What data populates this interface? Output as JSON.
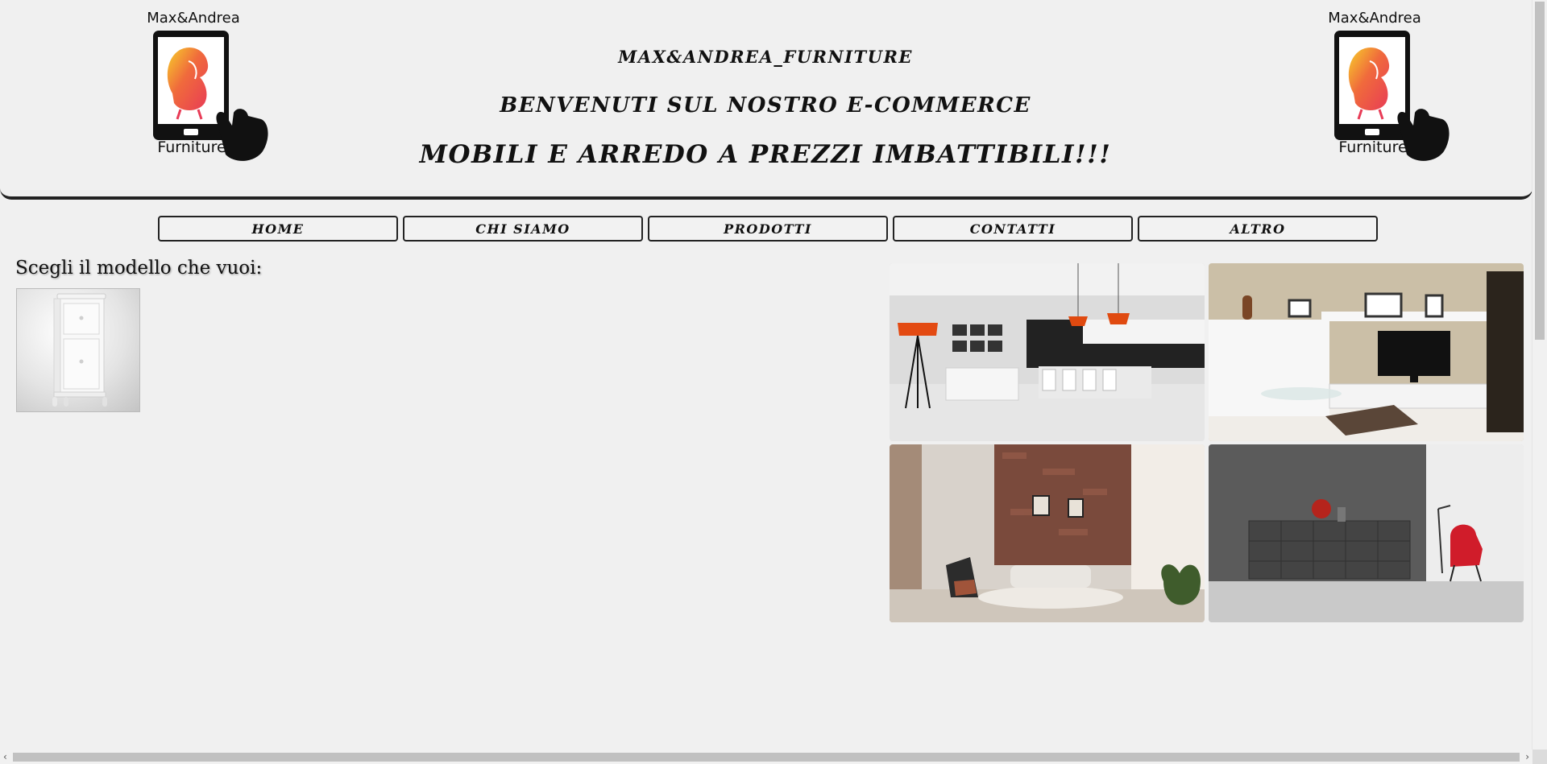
{
  "header": {
    "logo_top_text": "Max&Andrea",
    "logo_bottom_text": "Furniture",
    "title_line1": "MAX&ANDREA_FURNITURE",
    "title_line2": "BENVENUTI SUL NOSTRO E-COMMERCE",
    "title_line3": "MOBILI E ARREDO A PREZZI IMBATTIBILI!!!"
  },
  "nav": {
    "items": [
      {
        "label": "HOME"
      },
      {
        "label": "CHI SIAMO"
      },
      {
        "label": "PRODOTTI"
      },
      {
        "label": "CONTATTI"
      },
      {
        "label": "ALTRO"
      }
    ]
  },
  "main": {
    "choose_label": "Scegli il modello che vuoi:",
    "product_icon": "white-nightstand-image"
  },
  "gallery": {
    "images": [
      {
        "icon": "kitchen-dining-photo"
      },
      {
        "icon": "living-room-tv-photo"
      },
      {
        "icon": "loft-living-room-photo"
      },
      {
        "icon": "sideboard-armchair-photo"
      }
    ]
  },
  "scrollbar": {
    "left_arrow": "‹",
    "right_arrow": "›"
  },
  "colors": {
    "background": "#f0f0f0",
    "logo_chair": "#ee4b4b",
    "logo_chair_highlight": "#f5c028"
  }
}
